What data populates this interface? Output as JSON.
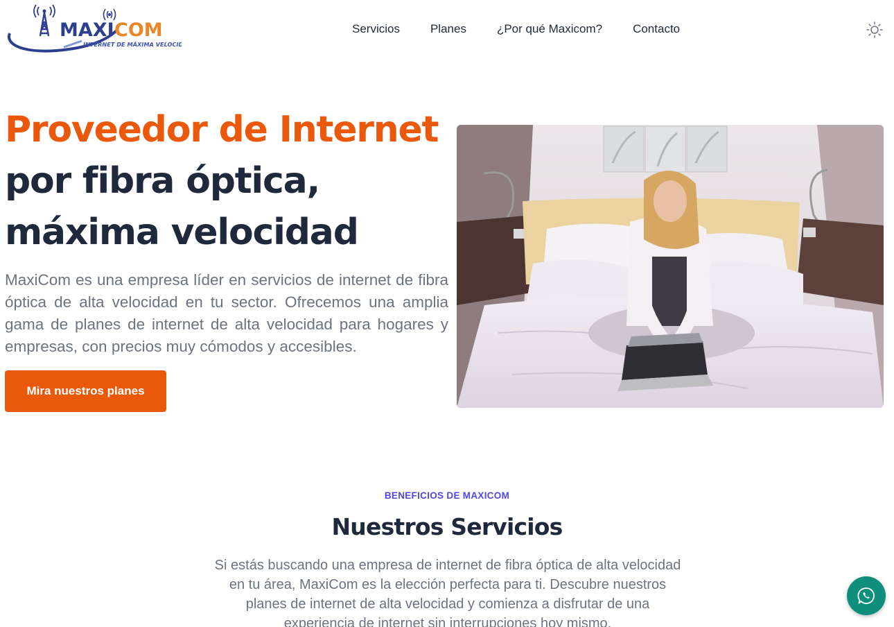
{
  "brand": {
    "name_left": "MAXI",
    "name_right": "COM",
    "tagline": "INTERNET DE MÁXIMA VELOCIDAD"
  },
  "nav": {
    "items": [
      {
        "label": "Servicios"
      },
      {
        "label": "Planes"
      },
      {
        "label": "¿Por qué Maxicom?"
      },
      {
        "label": "Contacto"
      }
    ]
  },
  "theme_toggle_icon": "sun-icon",
  "hero": {
    "title_line1": "Proveedor de Internet",
    "title_line2": "por fibra óptica,",
    "title_line3": "máxima velocidad",
    "description": "MaxiCom es una empresa líder en servicios de internet de fibra óptica de alta velocidad en tu sector. Ofrecemos una amplia gama de planes de internet de alta velocidad para hogares y empresas, con precios muy cómodos y accesibles.",
    "cta_label": "Mira nuestros planes"
  },
  "services": {
    "kicker": "BENEFICIOS DE MAXICOM",
    "title": "Nuestros Servicios",
    "description": "Si estás buscando una empresa de internet de fibra óptica de alta velocidad en tu área, MaxiCom es la elección perfecta para ti. Descubre nuestros planes de internet de alta velocidad y comienza a disfrutar de una experiencia de internet sin interrupciones hoy mismo."
  },
  "whatsapp_icon": "whatsapp-icon",
  "colors": {
    "accent": "#ea580c",
    "heading": "#1e293b",
    "kicker": "#4f46e5",
    "whatsapp": "#0f8e7b",
    "brand_blue": "#2c3e8f",
    "brand_orange": "#e8872a"
  }
}
